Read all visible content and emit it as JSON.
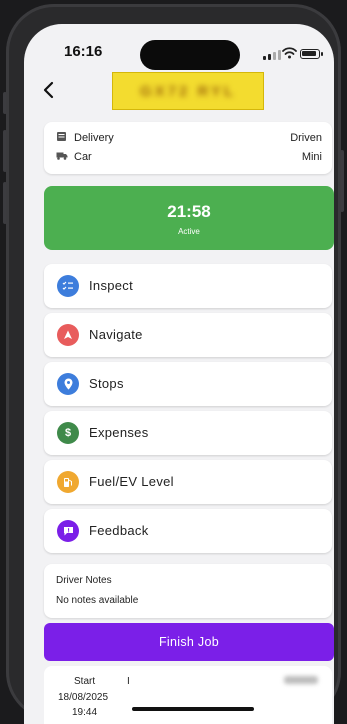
{
  "status_bar": {
    "time": "16:16"
  },
  "header": {
    "plate_text": "GX72 RYL"
  },
  "job_info": {
    "type_label": "Delivery",
    "type_value": "Driven",
    "vehicle_label": "Car",
    "vehicle_value": "Mini"
  },
  "timer": {
    "time": "21:58",
    "status": "Active",
    "color": "#4caf50"
  },
  "menu": [
    {
      "label": "Inspect",
      "icon": "checklist-icon",
      "color": "#3d7ddc"
    },
    {
      "label": "Navigate",
      "icon": "navigation-arrow-icon",
      "color": "#e85c5c"
    },
    {
      "label": "Stops",
      "icon": "location-pin-icon",
      "color": "#3d7ddc"
    },
    {
      "label": "Expenses",
      "icon": "dollar-icon",
      "color": "#3f8a4a"
    },
    {
      "label": "Fuel/EV Level",
      "icon": "fuel-pump-icon",
      "color": "#f0a830"
    },
    {
      "label": "Feedback",
      "icon": "feedback-icon",
      "color": "#7b1fe8"
    }
  ],
  "driver_notes": {
    "title": "Driver Notes",
    "value": "No notes available"
  },
  "finish_button": {
    "label": "Finish Job",
    "color": "#7b1fe8"
  },
  "timeline": {
    "start_label": "Start",
    "separator": "I",
    "start_date": "18/08/2025",
    "start_time": "19:44"
  }
}
